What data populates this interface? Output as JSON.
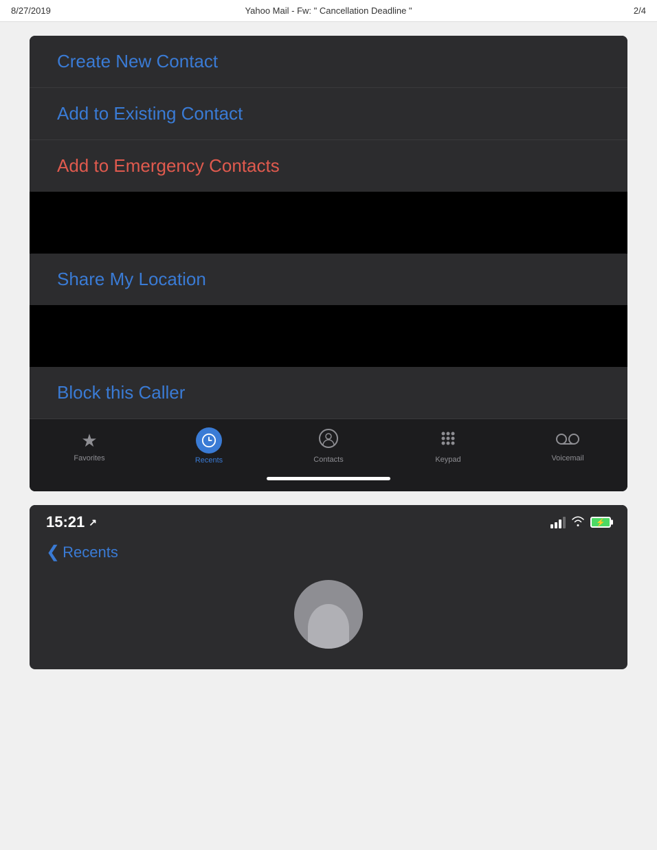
{
  "browser": {
    "date": "8/27/2019",
    "title": "Yahoo Mail - Fw: \" Cancellation Deadline \"",
    "page_num": "2/4"
  },
  "action_sheet": {
    "items": [
      {
        "id": "create-new-contact",
        "label": "Create New Contact",
        "color": "blue"
      },
      {
        "id": "add-to-existing-contact",
        "label": "Add to Existing Contact",
        "color": "blue"
      },
      {
        "id": "add-to-emergency-contacts",
        "label": "Add to Emergency Contacts",
        "color": "red"
      },
      {
        "id": "share-my-location",
        "label": "Share My Location",
        "color": "blue"
      },
      {
        "id": "block-this-caller",
        "label": "Block this Caller",
        "color": "blue"
      }
    ]
  },
  "tab_bar": {
    "items": [
      {
        "id": "favorites",
        "label": "Favorites",
        "icon": "★",
        "active": false
      },
      {
        "id": "recents",
        "label": "Recents",
        "icon": "⏱",
        "active": true
      },
      {
        "id": "contacts",
        "label": "Contacts",
        "icon": "👤",
        "active": false
      },
      {
        "id": "keypad",
        "label": "Keypad",
        "icon": "⠿",
        "active": false
      },
      {
        "id": "voicemail",
        "label": "Voicemail",
        "icon": "⏺",
        "active": false
      }
    ]
  },
  "status_bar": {
    "time": "15:21",
    "recents_label": "Recents"
  }
}
